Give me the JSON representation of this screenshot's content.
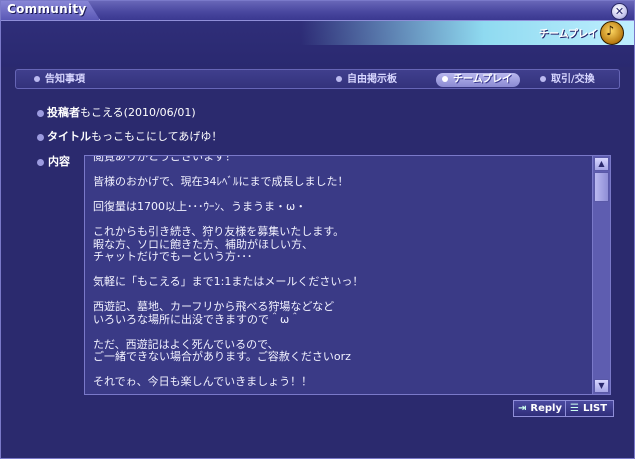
{
  "window": {
    "title": "Community",
    "close_glyph": "✕"
  },
  "banner": {
    "label": "チームプレイ",
    "icon": "trophy-badge-icon"
  },
  "nav": {
    "items": [
      {
        "label": "告知事項",
        "active": false
      },
      {
        "label": "自由掲示板",
        "active": false
      },
      {
        "label": "チームプレイ",
        "active": true
      },
      {
        "label": "取引/交換",
        "active": false
      }
    ]
  },
  "post": {
    "author_label": "投稿者",
    "author_value": "もこえる(2010/06/01)",
    "title_label": "タイトル",
    "title_value": "もっこもこにしてあげゆ！",
    "content_label": "内容",
    "content": "閲覧ありがとうございます！\n\n皆様のおかげで、現在34ﾚﾍﾞﾙにまで成長しました！\n\n回復量は1700以上･･･ｳｰﾝ、うまうま・ω・\n\nこれからも引き続き、狩り友様を募集いたします。\n暇な方、ソロに飽きた方、補助がほしい方、\nチャットだけでもーという方･･･\n\n気軽に「もこえる」まで1:1またはメールくださいっ！\n\n西遊記、墓地、カーフリから飛べる狩場などなど\nいろいろな場所に出没できますので＾ω＾\n\nただ、西遊記はよく死んでいるので、\nご一緒できない場合があります。ご容赦くださいorz\n\nそれでゎ、今日も楽しんでいきましょう！！"
  },
  "scrollbar": {
    "up_glyph": "▲",
    "down_glyph": "▼"
  },
  "buttons": {
    "reply": "Reply",
    "list": "LIST"
  },
  "colors": {
    "window_bg": "#2b2a6e",
    "accent": "#8fdaf0",
    "text": "#ffffff"
  }
}
